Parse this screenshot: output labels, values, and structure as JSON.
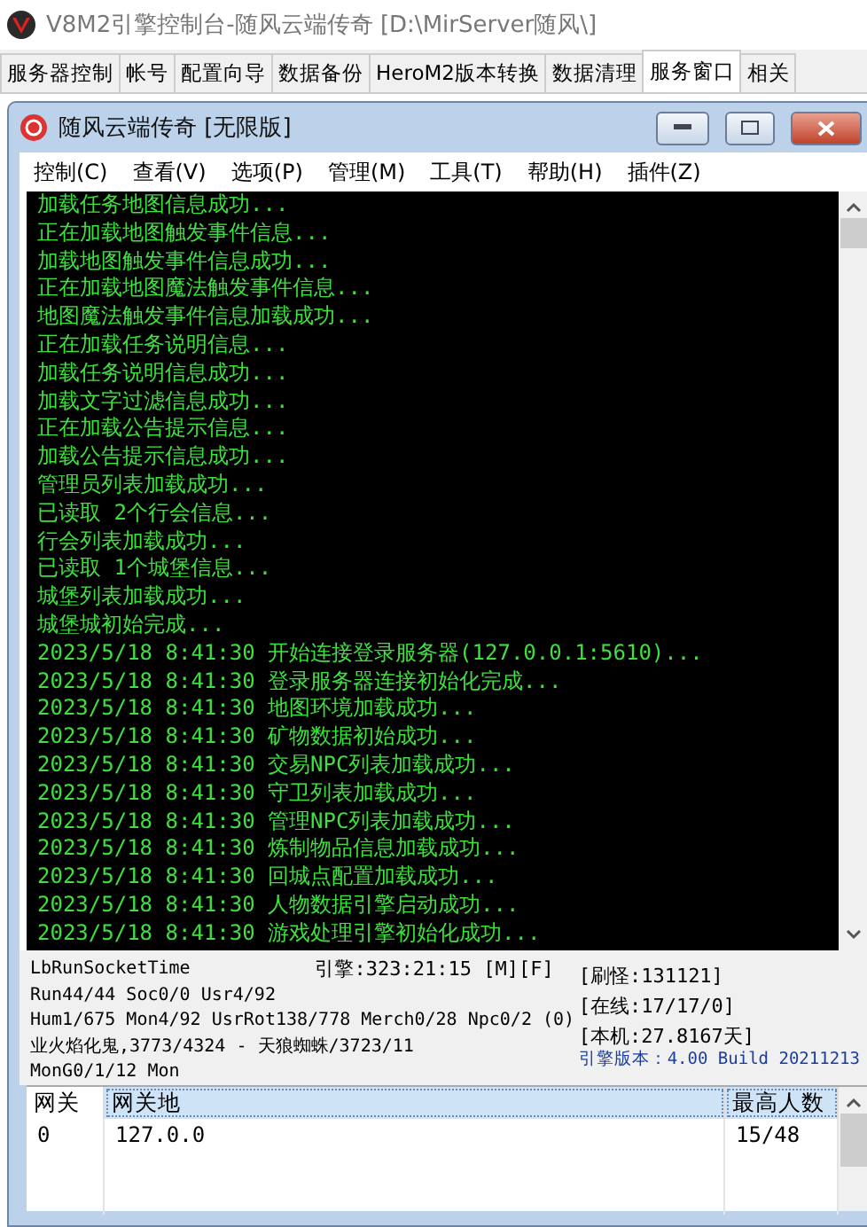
{
  "window": {
    "title": "V8M2引擎控制台-随风云端传奇 [D:\\MirServer随风\\]"
  },
  "tabs": [
    {
      "label": "服务器控制",
      "selected": false
    },
    {
      "label": "帐号",
      "selected": false
    },
    {
      "label": "配置向导",
      "selected": false
    },
    {
      "label": "数据备份",
      "selected": false
    },
    {
      "label": "HeroM2版本转换",
      "selected": false
    },
    {
      "label": "数据清理",
      "selected": false
    },
    {
      "label": "服务窗口",
      "selected": true
    },
    {
      "label": "相关",
      "selected": false
    }
  ],
  "inner_window": {
    "title": "随风云端传奇 [无限版]",
    "menu": [
      "控制(C)",
      "查看(V)",
      "选项(P)",
      "管理(M)",
      "工具(T)",
      "帮助(H)",
      "插件(Z)"
    ]
  },
  "console": {
    "lines": [
      "加载任务地图信息成功...",
      "正在加载地图触发事件信息...",
      "加载地图触发事件信息成功...",
      "正在加载地图魔法触发事件信息...",
      "地图魔法触发事件信息加载成功...",
      "正在加载任务说明信息...",
      "加载任务说明信息成功...",
      "加载文字过滤信息成功...",
      "正在加载公告提示信息...",
      "加载公告提示信息成功...",
      "管理员列表加载成功...",
      "已读取 2个行会信息...",
      "行会列表加载成功...",
      "已读取 1个城堡信息...",
      "城堡列表加载成功...",
      "城堡城初始完成...",
      "2023/5/18 8:41:30 开始连接登录服务器(127.0.0.1:5610)...",
      "2023/5/18 8:41:30 登录服务器连接初始化完成...",
      "2023/5/18 8:41:30 地图环境加载成功...",
      "2023/5/18 8:41:30 矿物数据初始成功...",
      "2023/5/18 8:41:30 交易NPC列表加载成功...",
      "2023/5/18 8:41:30 守卫列表加载成功...",
      "2023/5/18 8:41:30 管理NPC列表加载成功...",
      "2023/5/18 8:41:30 炼制物品信息加载成功...",
      "2023/5/18 8:41:30 回城点配置加载成功...",
      "2023/5/18 8:41:30 人物数据引擎启动成功...",
      "2023/5/18 8:41:30 游戏处理引擎初始化成功..."
    ]
  },
  "status": {
    "left_lines": [
      "LbRunSocketTime",
      "Run44/44 Soc0/0 Usr4/92",
      "Hum1/675 Mon4/92 UsrRot138/778 Merch0/28 Npc0/2 (0)",
      "业火焰化鬼,3773/4324 - 天狼蜘蛛/3723/11",
      "MonG0/1/12 Mon"
    ],
    "engine": "引擎:323:21:15 [M][F]",
    "right_lines": [
      "[刷怪:131121]",
      "[在线:17/17/0]",
      "[本机:27.8167天]"
    ],
    "version": "引擎版本：4.00 Build 20211213"
  },
  "table": {
    "columns": [
      {
        "label": "网关",
        "highlighted": false
      },
      {
        "label": "网关地",
        "highlighted": true
      },
      {
        "label": "最高人数",
        "highlighted": true
      }
    ],
    "rows": [
      [
        "0",
        "127.0.0",
        "15/48"
      ]
    ]
  }
}
